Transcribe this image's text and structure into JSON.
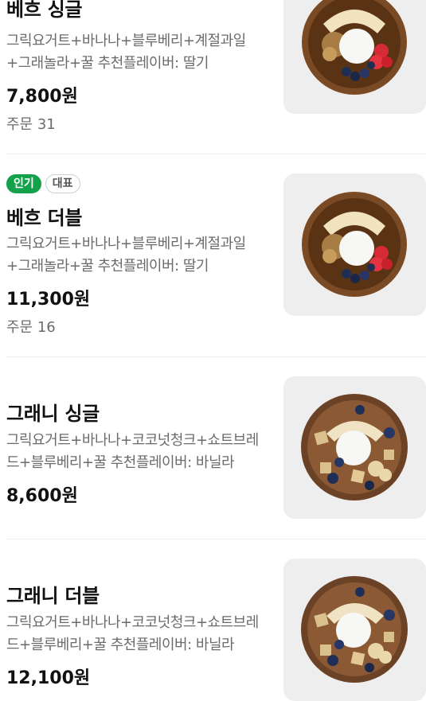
{
  "menu_items": [
    {
      "name": "베흐 싱글",
      "description": "그릭요거트+바나나+블루베리+계절과일+그래놀라+꿀 추천플레이버: 딸기",
      "price": "7,800원",
      "orders_label": "주문",
      "orders_count": "31",
      "image_icon": "berry-bowl-photo"
    },
    {
      "badges": [
        "인기",
        "대표"
      ],
      "name": "베흐 더블",
      "description": "그릭요거트+바나나+블루베리+계절과일+그래놀라+꿀 추천플레이버: 딸기",
      "price": "11,300원",
      "orders_label": "주문",
      "orders_count": "16",
      "image_icon": "berry-bowl-photo"
    },
    {
      "name": "그래니 싱글",
      "description": "그릭요거트+바나나+코코넛청크+쇼트브레드+블루베리+꿀 추천플레이버: 바닐라",
      "price": "8,600원",
      "image_icon": "granny-bowl-photo"
    },
    {
      "name": "그래니 더블",
      "description": "그릭요거트+바나나+코코넛청크+쇼트브레드+블루베리+꿀 추천플레이버: 바닐라",
      "price": "12,100원",
      "image_icon": "granny-bowl-photo"
    }
  ],
  "colors": {
    "badge_popular": "#13a24a",
    "text_primary": "#111111",
    "text_secondary": "#6b6b6b",
    "thumb_bg": "#eeeeee",
    "divider": "#ececec"
  }
}
